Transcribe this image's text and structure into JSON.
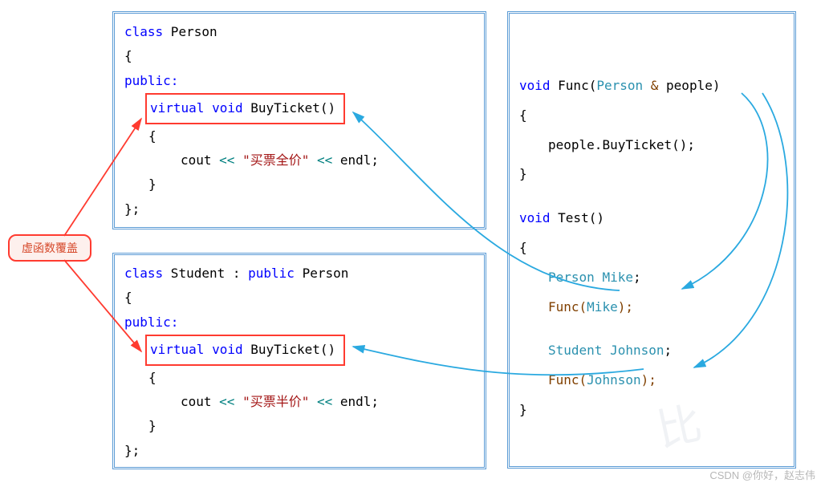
{
  "label": {
    "text": "虚函数覆盖"
  },
  "person": {
    "line1_class": "class",
    "line1_name": " Person",
    "brace_open": "{",
    "public": "public:",
    "virtual_kw": "virtual void",
    "virtual_fn": " BuyTicket()",
    "fn_open": "{",
    "cout_pre": "cout ",
    "cout_op": "<<",
    "cout_str": " \"买票全价\" ",
    "cout_op2": "<<",
    "cout_end": " endl;",
    "fn_close": "}",
    "brace_close": "};"
  },
  "student": {
    "line1_class": "class",
    "line1_name": " Student",
    "line1_mid": " : ",
    "line1_pub": "public",
    "line1_base": " Person",
    "brace_open": "{",
    "public": "public:",
    "virtual_kw": "virtual void",
    "virtual_fn": " BuyTicket()",
    "fn_open": "{",
    "cout_pre": "cout ",
    "cout_op": "<<",
    "cout_str": " \"买票半价\" ",
    "cout_op2": "<<",
    "cout_end": " endl;",
    "fn_close": "}",
    "brace_close": "};"
  },
  "func": {
    "sig_void": "void",
    "sig_name": " Func(",
    "sig_type": "Person ",
    "sig_amp": "&",
    "sig_param": " people)",
    "open": "{",
    "call_obj": "people.",
    "call_fn": "BuyTicket()",
    "call_semi": ";",
    "close": "}"
  },
  "test": {
    "sig_void": "void",
    "sig_name": " Test()",
    "open": "{",
    "p_decl_type": "Person ",
    "p_decl_name": "Mike",
    "p_decl_end": ";",
    "p_call_fn": "Func(",
    "p_call_arg": "Mike",
    "p_call_end": ");",
    "s_decl_type": "Student ",
    "s_decl_name": "Johnson",
    "s_decl_end": ";",
    "s_call_fn": "Func(",
    "s_call_arg": "Johnson",
    "s_call_end": ");",
    "close": "}"
  },
  "watermark": {
    "text": "CSDN @你好，赵志伟"
  }
}
